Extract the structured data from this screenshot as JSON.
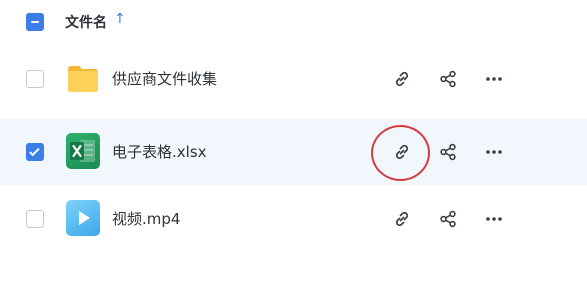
{
  "header": {
    "select_all_state": "indeterminate",
    "column_name_label": "文件名",
    "sort_indicator": "↑",
    "sort_icon": "arrow-up-icon"
  },
  "files": [
    {
      "name": "供应商文件收集",
      "type": "folder",
      "icon": "folder-icon",
      "checked": false
    },
    {
      "name": "电子表格.xlsx",
      "type": "spreadsheet",
      "icon": "excel-file-icon",
      "checked": true
    },
    {
      "name": "视频.mp4",
      "type": "video",
      "icon": "video-file-icon",
      "checked": false
    }
  ],
  "row_actions": [
    "link-icon",
    "share-icon",
    "more-icon"
  ],
  "highlight": {
    "target": "电子表格.xlsx link action",
    "color": "#d63c3c"
  },
  "colors": {
    "accent": "#3b7de9",
    "selected_row_bg": "#f2f7fd",
    "folder": "#f8c847",
    "excel": "#21a366",
    "video": "#5cc0f5"
  }
}
